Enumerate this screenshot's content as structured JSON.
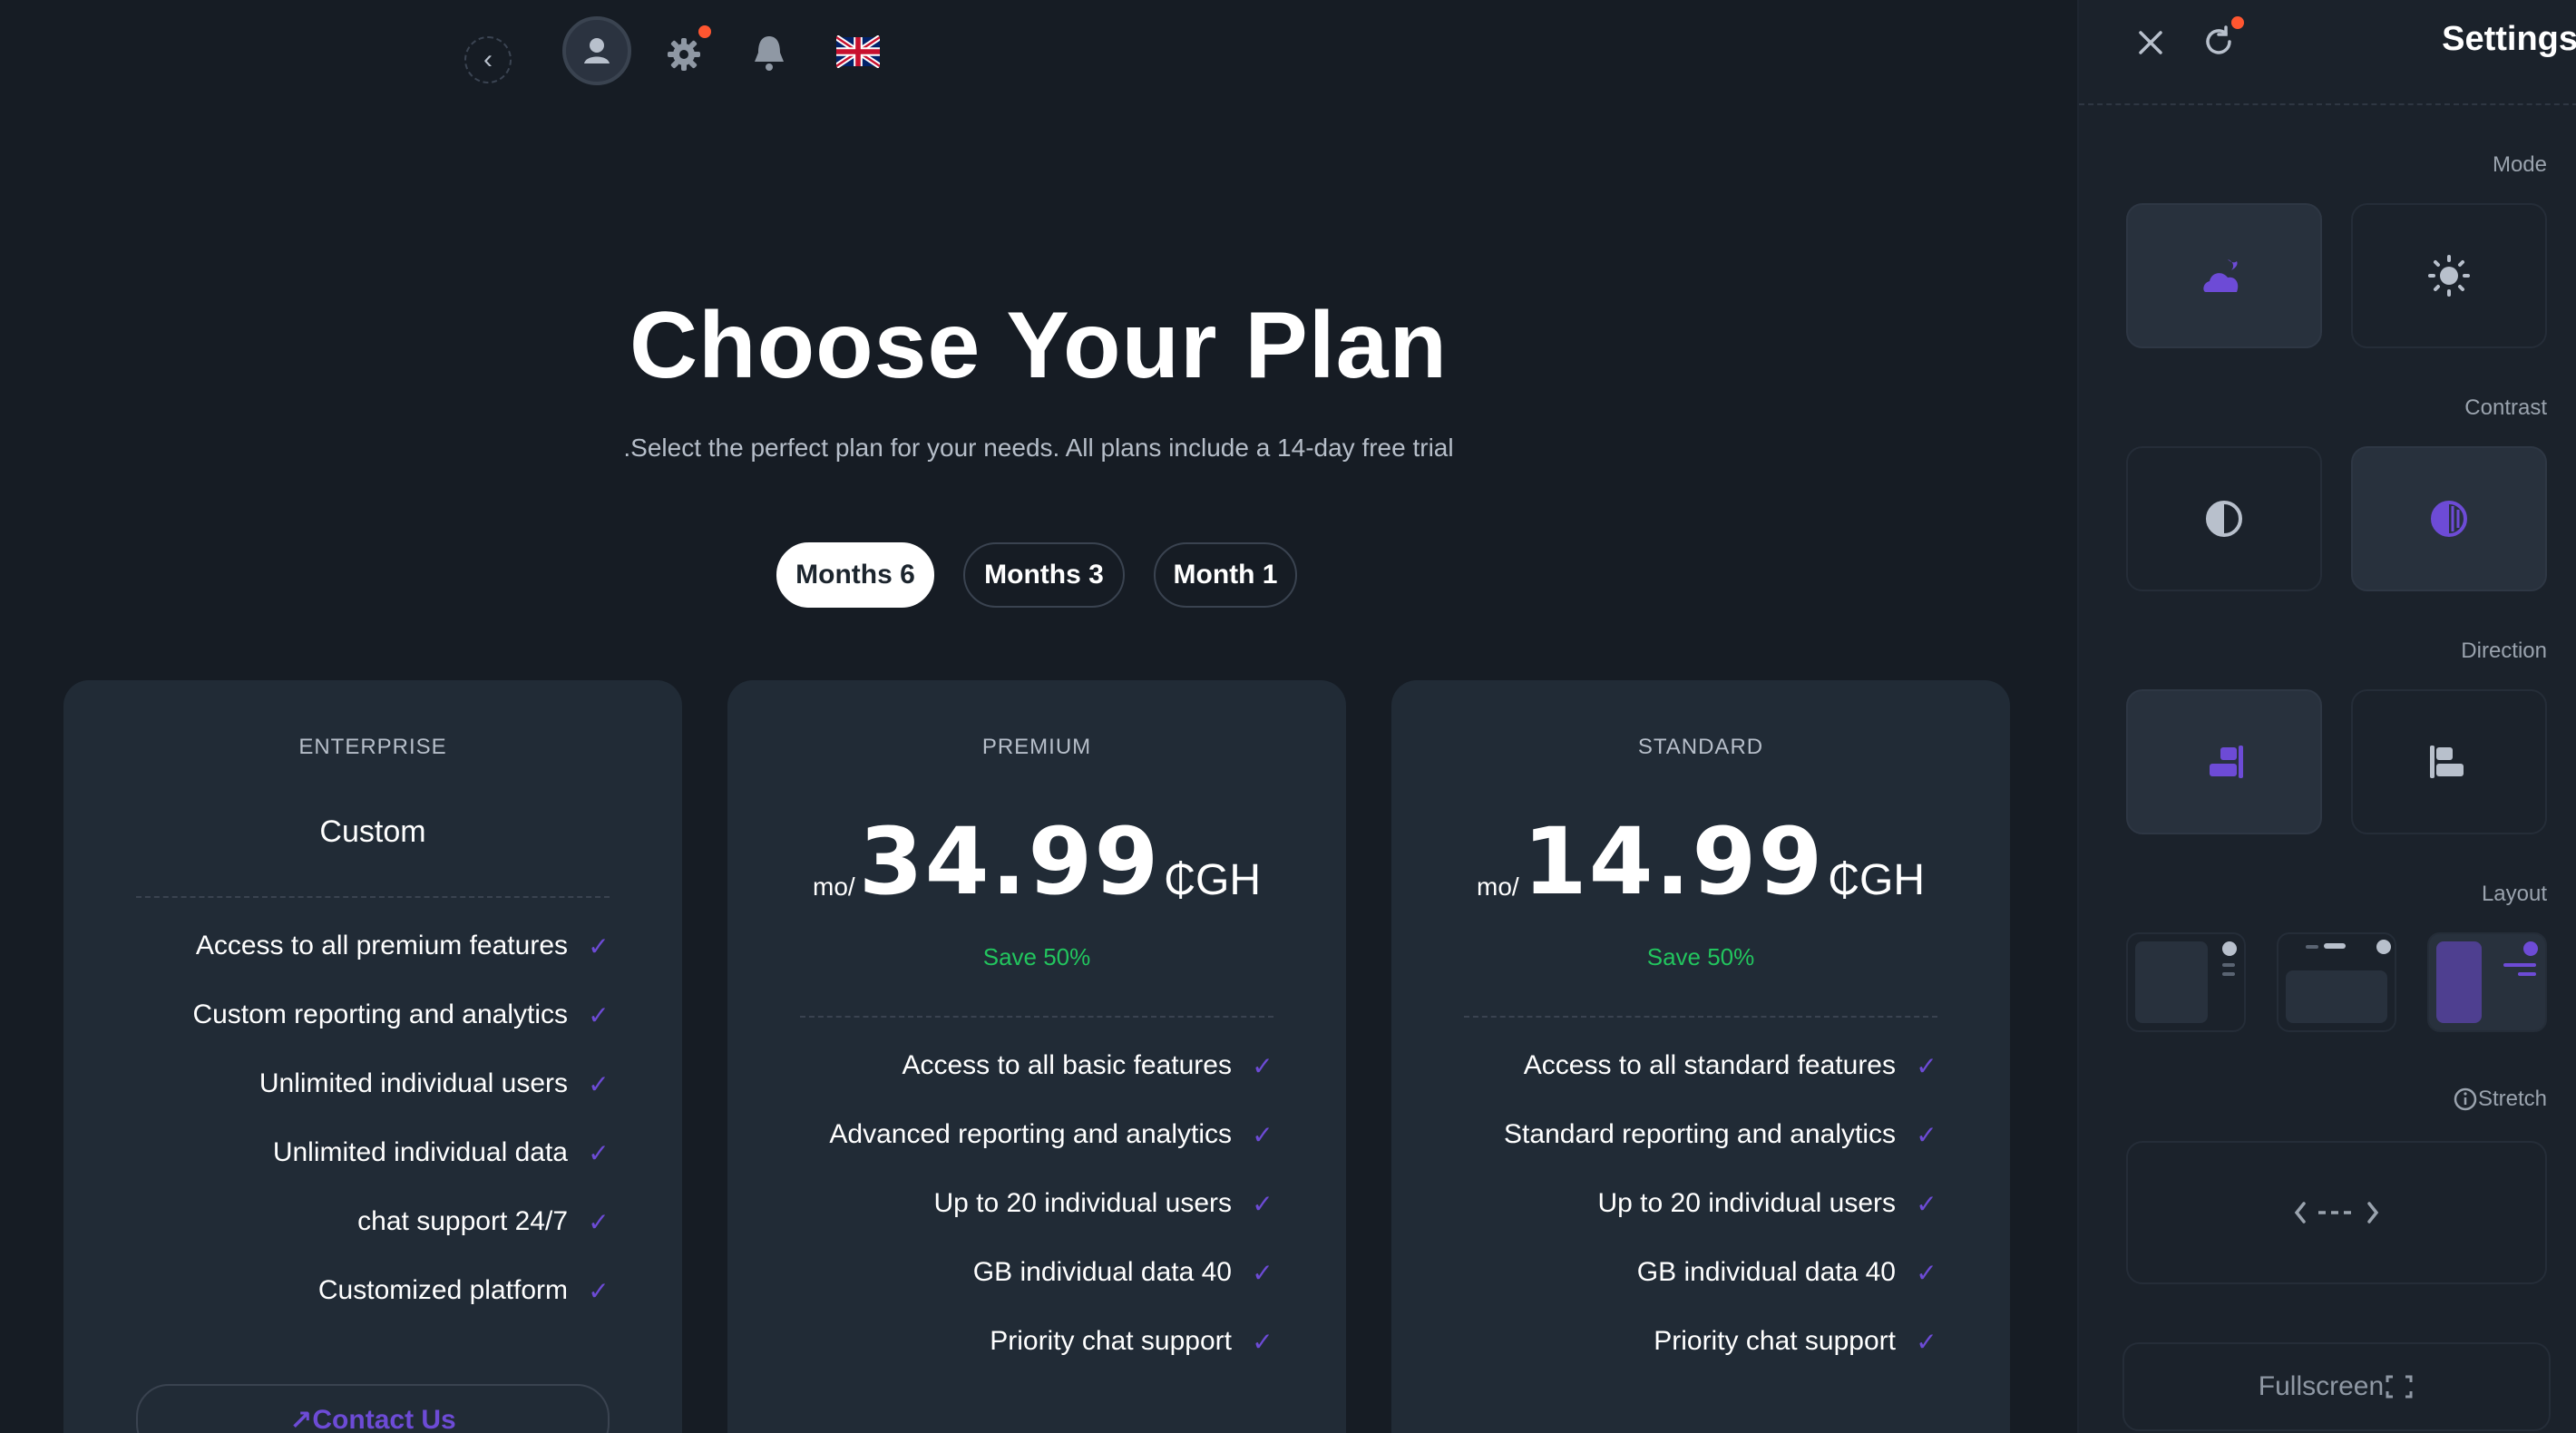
{
  "page": {
    "title": "Choose Your Plan",
    "subtitle": ".Select the perfect plan for your needs. All plans include a 14-day free trial"
  },
  "tabs": [
    {
      "label": "Months 6",
      "active": true
    },
    {
      "label": "Months 3",
      "active": false
    },
    {
      "label": "Month 1",
      "active": false
    }
  ],
  "plans": {
    "enterprise": {
      "name": "ENTERPRISE",
      "price_label": "Custom",
      "features": [
        "Access to all premium features",
        "Custom reporting and analytics",
        "Unlimited individual users",
        "Unlimited individual data",
        "chat support 24/7",
        "Customized platform"
      ],
      "cta": "Contact Us"
    },
    "premium": {
      "name": "PREMIUM",
      "per": "mo/",
      "amount": "34.99",
      "currency": "₵GH",
      "save": "Save 50%",
      "features": [
        "Access to all basic features",
        "Advanced reporting and analytics",
        "Up to 20 individual users",
        "GB individual data 40",
        "Priority chat support"
      ]
    },
    "standard": {
      "name": "STANDARD",
      "per": "mo/",
      "amount": "14.99",
      "currency": "₵GH",
      "save": "Save 50%",
      "features": [
        "Access to all standard features",
        "Standard reporting and analytics",
        "Up to 20 individual users",
        "GB individual data 40",
        "Priority chat support"
      ]
    }
  },
  "settings": {
    "title": "Settings",
    "mode_label": "Mode",
    "contrast_label": "Contrast",
    "direction_label": "Direction",
    "layout_label": "Layout",
    "stretch_label": "Stretch",
    "fullscreen_label": "Fullscreen"
  },
  "colors": {
    "background": "#161c24",
    "card": "#212b36",
    "accent": "#6d4bd6",
    "success": "#22c55e",
    "notification": "#ff5630"
  },
  "icons": [
    "back-chevron-icon",
    "user-icon",
    "gear-icon",
    "bell-icon",
    "uk-flag-icon",
    "close-icon",
    "refresh-icon",
    "moon-icon",
    "sun-icon",
    "contrast-icon",
    "rtl-icon",
    "ltr-icon",
    "check-icon",
    "info-icon",
    "fullscreen-icon"
  ]
}
